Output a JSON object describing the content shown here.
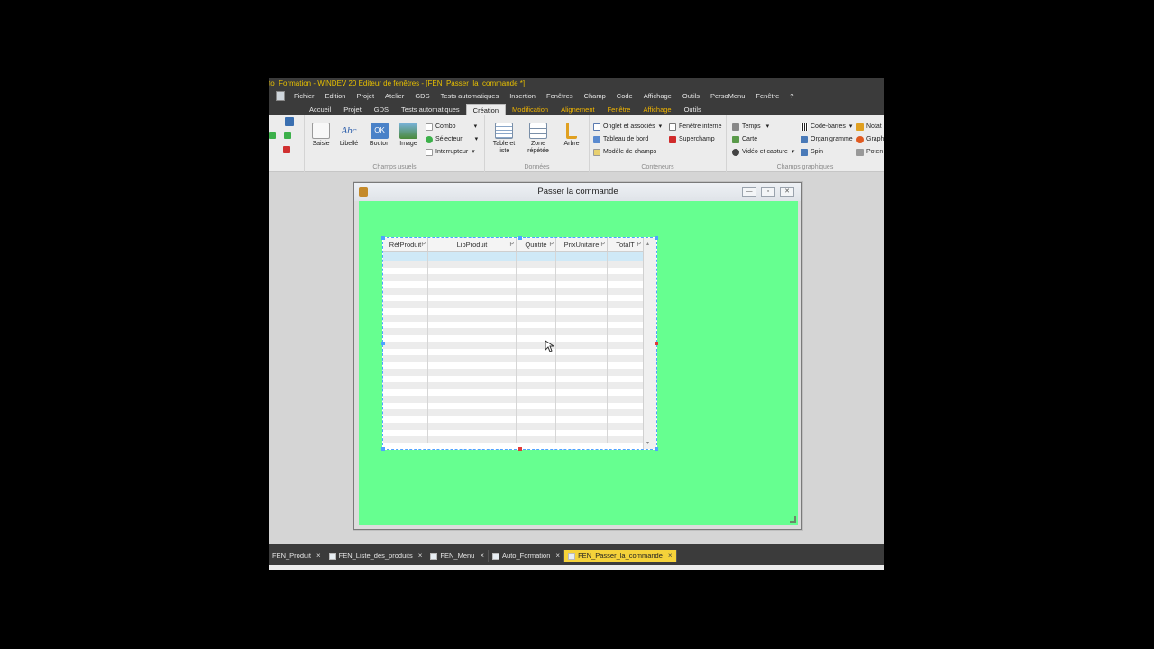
{
  "app": {
    "title": "to_Formation - WINDEV 20  Editeur de fenêtres - [FEN_Passer_la_commande *]"
  },
  "menu": [
    "Fichier",
    "Edition",
    "Projet",
    "Atelier",
    "GDS",
    "Tests automatiques",
    "Insertion",
    "Fenêtres",
    "Champ",
    "Code",
    "Affichage",
    "Outils",
    "PersoMenu",
    "Fenêtre",
    "?"
  ],
  "ribbon_tabs": [
    {
      "label": "Accueil",
      "kind": "normal"
    },
    {
      "label": "Projet",
      "kind": "normal"
    },
    {
      "label": "GDS",
      "kind": "normal"
    },
    {
      "label": "Tests automatiques",
      "kind": "normal"
    },
    {
      "label": "Création",
      "kind": "active"
    },
    {
      "label": "Modification",
      "kind": "ctx"
    },
    {
      "label": "Alignement",
      "kind": "ctx"
    },
    {
      "label": "Fenêtre",
      "kind": "ctx"
    },
    {
      "label": "Affichage",
      "kind": "ctx"
    },
    {
      "label": "Outils",
      "kind": "normal"
    }
  ],
  "ribbon": {
    "champs_usuels": {
      "label": "Champs usuels",
      "saisie": "Saisie",
      "libelle": "Libellé",
      "bouton": "Bouton",
      "image": "Image",
      "combo": "Combo",
      "selecteur": "Sélecteur",
      "interrupteur": "Interrupteur",
      "abc": "Abc",
      "ok": "OK"
    },
    "donnees": {
      "label": "Données",
      "table": "Table et liste",
      "zone": "Zone répétée",
      "arbre": "Arbre"
    },
    "conteneurs": {
      "label": "Conteneurs",
      "onglet": "Onglet et associés",
      "tableau": "Tableau de bord",
      "modele": "Modèle de champs",
      "fenetre_interne": "Fenêtre interne",
      "superchamp": "Superchamp"
    },
    "champs_graphiques": {
      "label": "Champs graphiques",
      "temps": "Temps",
      "carte": "Carte",
      "video": "Vidéo et capture",
      "code_barres": "Code-barres",
      "organigramme": "Organigramme",
      "spin": "Spin",
      "notation": "Notat",
      "graph": "Graph",
      "potentiometre": "Poten"
    }
  },
  "window": {
    "title": "Passer la commande",
    "min": "—",
    "max": "▫",
    "close": "✕"
  },
  "table": {
    "columns": [
      {
        "label": "RéfProduit",
        "sort": "P"
      },
      {
        "label": "LibProduit",
        "sort": "P"
      },
      {
        "label": "Quntite",
        "sort": "P"
      },
      {
        "label": "PrixUnitaire",
        "sort": "P"
      },
      {
        "label": "TotalT",
        "sort": "P"
      }
    ],
    "row_count": 28
  },
  "bottom_tabs": [
    {
      "label": "FEN_Produit",
      "active": false
    },
    {
      "label": "FEN_Liste_des_produits",
      "active": false
    },
    {
      "label": "FEN_Menu",
      "active": false
    },
    {
      "label": "Auto_Formation",
      "active": false
    },
    {
      "label": "FEN_Passer_la_commande",
      "active": true
    }
  ],
  "colors": {
    "window_bg": "#66ff90",
    "accent_tab": "#f0b400",
    "active_doc_tab": "#f5d23a"
  }
}
